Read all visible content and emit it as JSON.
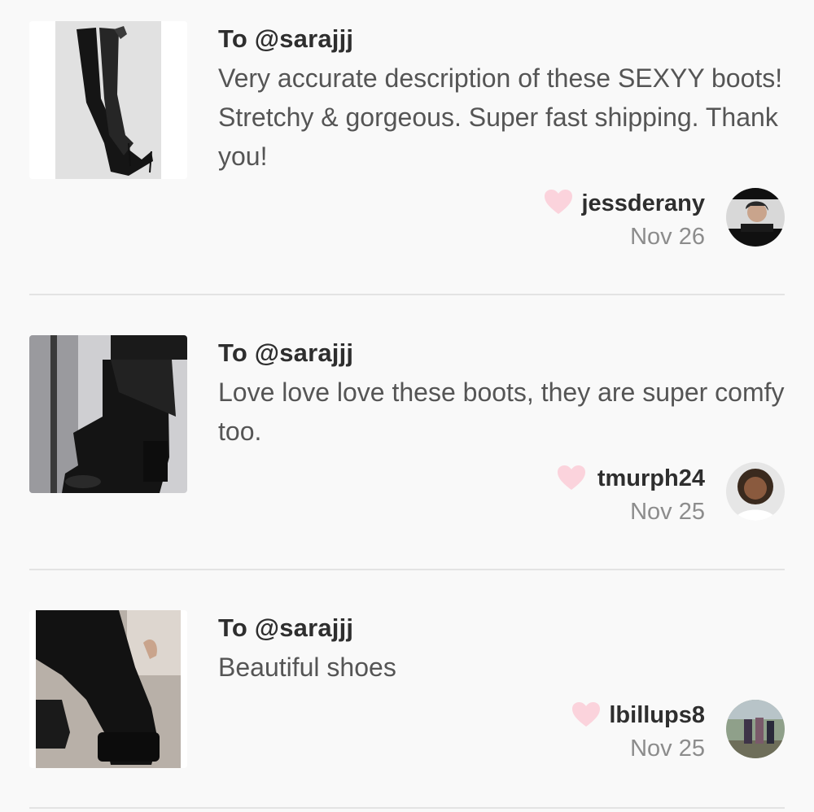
{
  "reviews": [
    {
      "to": "To @sarajjj",
      "text": "Very accurate description of these SEXYY boots! Stretchy & gorgeous. Super fast shipping. Thank you!",
      "username": "jessderany",
      "date": "Nov 26",
      "image_icon": "thigh-high-boots-photo",
      "avatar_icon": "user-avatar-photo"
    },
    {
      "to": "To @sarajjj",
      "text": "Love love love these boots, they are super comfy too.",
      "username": "tmurph24",
      "date": "Nov 25",
      "image_icon": "peep-toe-booties-photo",
      "avatar_icon": "user-avatar-photo"
    },
    {
      "to": "To @sarajjj",
      "text": "Beautiful shoes",
      "username": "lbillups8",
      "date": "Nov 25",
      "image_icon": "platform-lace-up-boots-photo",
      "avatar_icon": "user-avatar-photo"
    }
  ],
  "colors": {
    "background": "#f9f9f9",
    "heart": "#fbd3dc",
    "username": "#2e2e2e",
    "date": "#8c8c8c",
    "text": "#555555",
    "divider": "#e3e3e3"
  }
}
